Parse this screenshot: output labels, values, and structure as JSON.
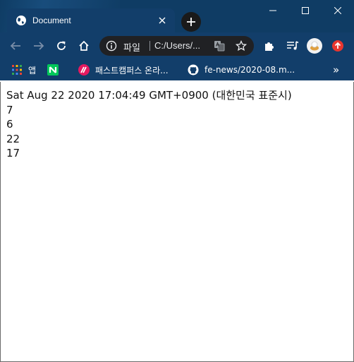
{
  "window": {
    "tab_title": "Document",
    "controls": {
      "minimize": "minimize",
      "maximize": "maximize",
      "close": "close"
    }
  },
  "toolbar": {
    "omnibox": {
      "scheme_label": "파일",
      "url": "C:/Users/..."
    }
  },
  "bookmarks": {
    "items": [
      {
        "label": "앱",
        "icon": "apps-grid-icon"
      },
      {
        "label": "",
        "icon": "naver-icon"
      },
      {
        "label": "패스트캠퍼스 온라...",
        "icon": "fastcampus-icon"
      },
      {
        "label": "fe-news/2020-08.m...",
        "icon": "github-icon"
      }
    ],
    "overflow": "»"
  },
  "page": {
    "lines": [
      "Sat Aug 22 2020 17:04:49 GMT+0900 (대한민국 표준시)",
      "7",
      "6",
      "22",
      "17"
    ]
  },
  "colors": {
    "frame": "#123e6a",
    "omnibox": "#202124",
    "page_bg": "#ffffff"
  }
}
